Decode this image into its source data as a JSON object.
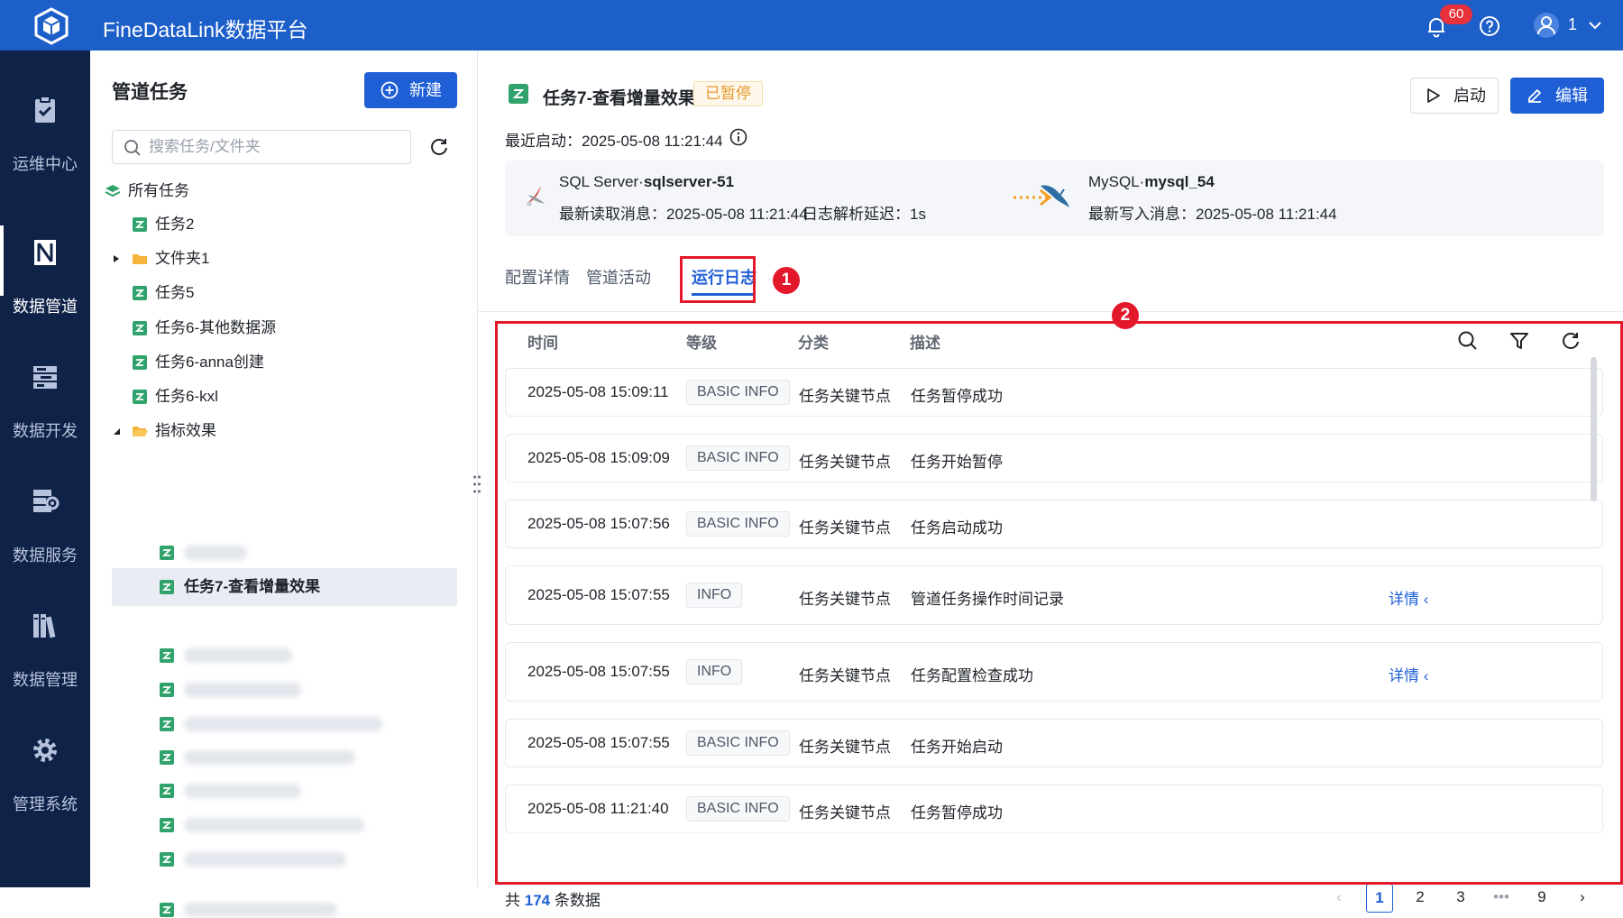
{
  "app": {
    "title": "FineDataLink数据平台",
    "notification_count": "60",
    "user_name": "1"
  },
  "nav": [
    {
      "label": "运维中心",
      "icon": "clipboard-check-icon"
    },
    {
      "label": "数据管道",
      "icon": "pipeline-icon"
    },
    {
      "label": "数据开发",
      "icon": "dev-icon"
    },
    {
      "label": "数据服务",
      "icon": "service-icon"
    },
    {
      "label": "数据管理",
      "icon": "manage-icon"
    },
    {
      "label": "管理系统",
      "icon": "gear-icon"
    }
  ],
  "tree": {
    "title": "管道任务",
    "new_label": "新建",
    "search_placeholder": "搜索任务/文件夹",
    "all": "所有任务",
    "items": [
      "任务2",
      "文件夹1",
      "任务5",
      "任务6-其他数据源",
      "任务6-anna创建",
      "任务6-kxl",
      "指标效果",
      "任务7-查看增量效果"
    ]
  },
  "task": {
    "name": "任务7-查看增量效果",
    "status": "已暂停",
    "start_label": "启动",
    "edit_label": "编辑",
    "recent_start": "最近启动：2025-05-08 11:21:44",
    "source_type": "SQL Server·",
    "source_name": "sqlserver-51",
    "source_read": "最新读取消息：2025-05-08 11:21:44",
    "source_delay": "日志解析延迟：1s",
    "target_type": "MySQL·",
    "target_name": "mysql_54",
    "target_write": "最新写入消息：2025-05-08 11:21:44"
  },
  "tabs": [
    "配置详情",
    "管道活动",
    "运行日志"
  ],
  "annotations": [
    "1",
    "2"
  ],
  "log": {
    "columns": [
      "时间",
      "等级",
      "分类",
      "描述"
    ],
    "detail_label": "详情",
    "rows": [
      {
        "time": "2025-05-08 15:09:11",
        "level": "BASIC INFO",
        "category": "任务关键节点",
        "desc": "任务暂停成功"
      },
      {
        "time": "2025-05-08 15:09:09",
        "level": "BASIC INFO",
        "category": "任务关键节点",
        "desc": "任务开始暂停"
      },
      {
        "time": "2025-05-08 15:07:56",
        "level": "BASIC INFO",
        "category": "任务关键节点",
        "desc": "任务启动成功"
      },
      {
        "time": "2025-05-08 15:07:55",
        "level": "INFO",
        "category": "任务关键节点",
        "desc": "管道任务操作时间记录"
      },
      {
        "time": "2025-05-08 15:07:55",
        "level": "INFO",
        "category": "任务关键节点",
        "desc": "任务配置检查成功"
      },
      {
        "time": "2025-05-08 15:07:55",
        "level": "BASIC INFO",
        "category": "任务关键节点",
        "desc": "任务开始启动"
      },
      {
        "time": "2025-05-08 11:21:40",
        "level": "BASIC INFO",
        "category": "任务关键节点",
        "desc": "任务暂停成功"
      }
    ],
    "total_prefix": "共",
    "total": "174",
    "total_suffix": "条数据",
    "pages": [
      "1",
      "2",
      "3",
      "•••",
      "9"
    ]
  },
  "colors": {
    "brand": "#1d5fc9",
    "sidenav": "#0f2248",
    "annotation": "#e3192b",
    "paused": "#e59a2c"
  }
}
